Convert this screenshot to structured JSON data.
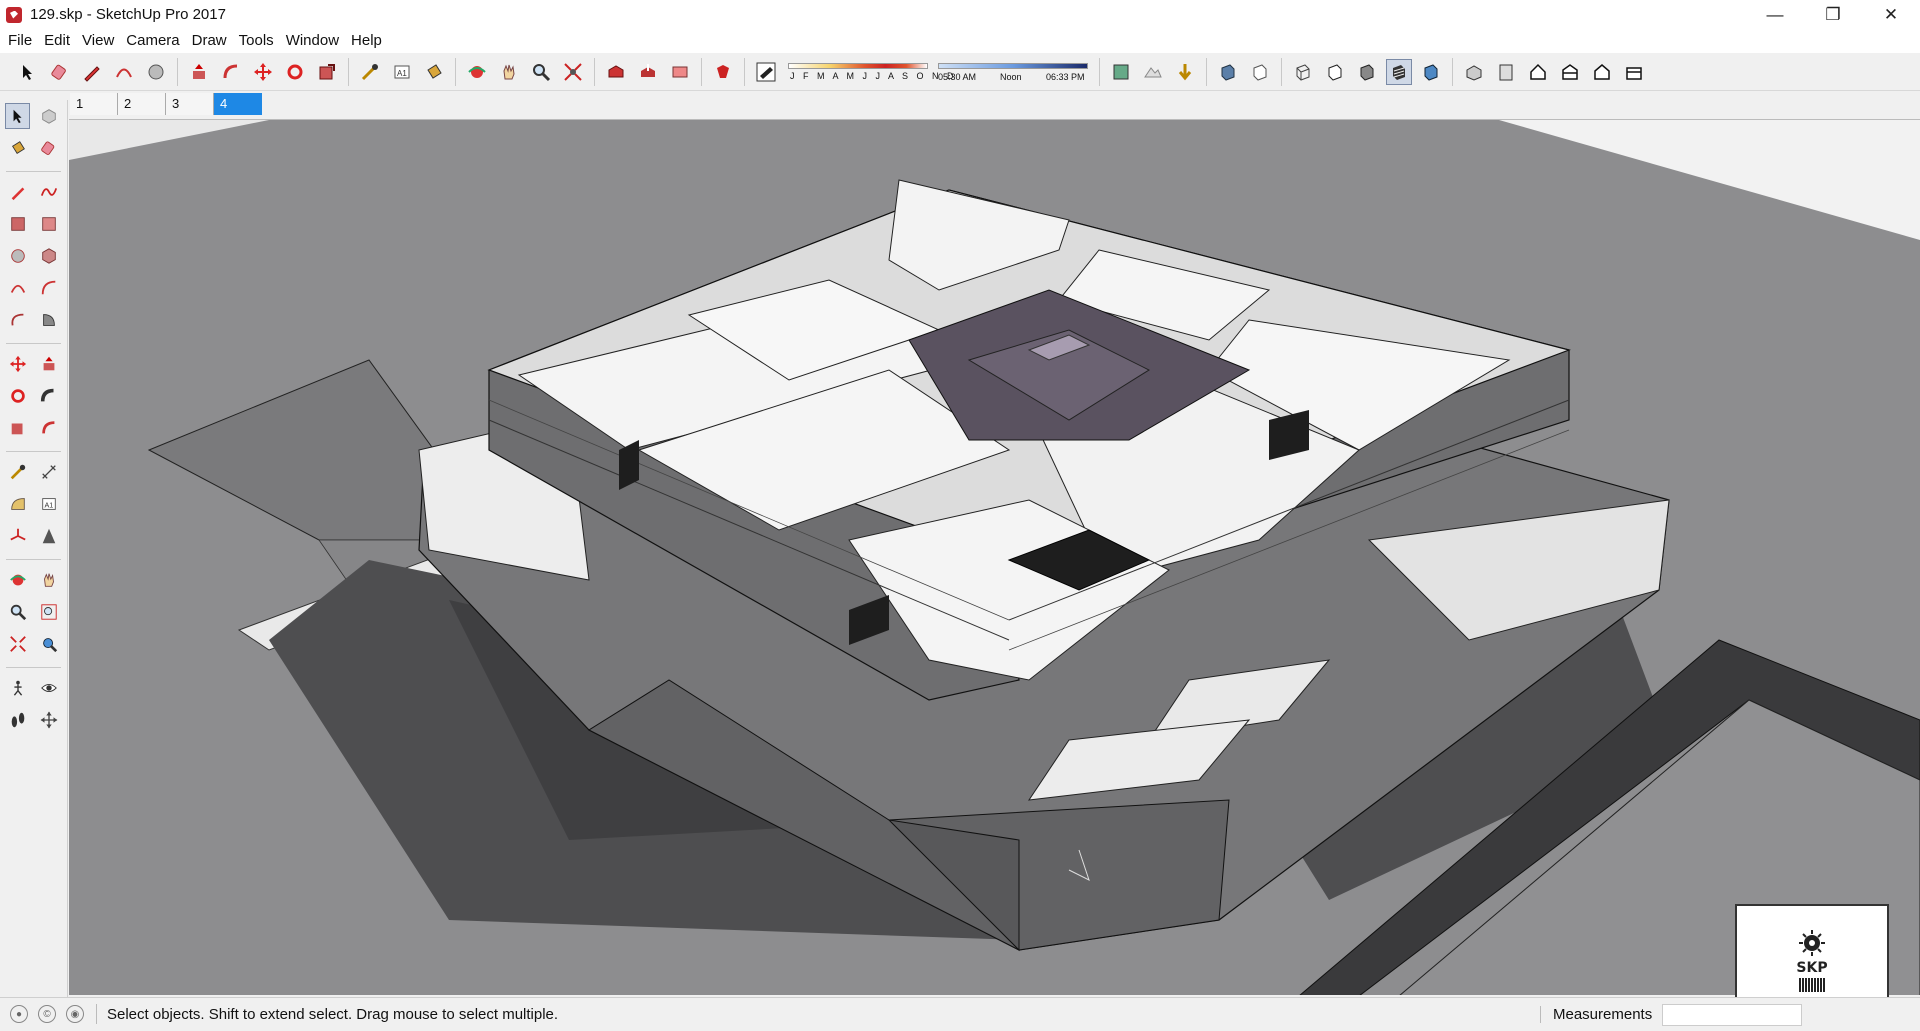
{
  "window": {
    "title": "129.skp - SketchUp Pro 2017",
    "minimize": "—",
    "maximize": "❐",
    "close": "✕"
  },
  "menu": [
    "File",
    "Edit",
    "View",
    "Camera",
    "Draw",
    "Tools",
    "Window",
    "Help"
  ],
  "toolbar": {
    "months": "J F M A M J J A S O N D",
    "time_start": "05:30 AM",
    "time_mid": "Noon",
    "time_end": "06:33 PM"
  },
  "scenes": [
    "1",
    "2",
    "3",
    "4"
  ],
  "active_scene": "4",
  "status": {
    "message": "Select objects. Shift to extend select. Drag mouse to select multiple.",
    "measurements_label": "Measurements",
    "measurements_value": ""
  },
  "thumbnail": {
    "logo_text": "SKP"
  },
  "colors": {
    "active_tab": "#1e88e5",
    "ground": "#8c8c8e",
    "brand_red": "#c0262d"
  }
}
